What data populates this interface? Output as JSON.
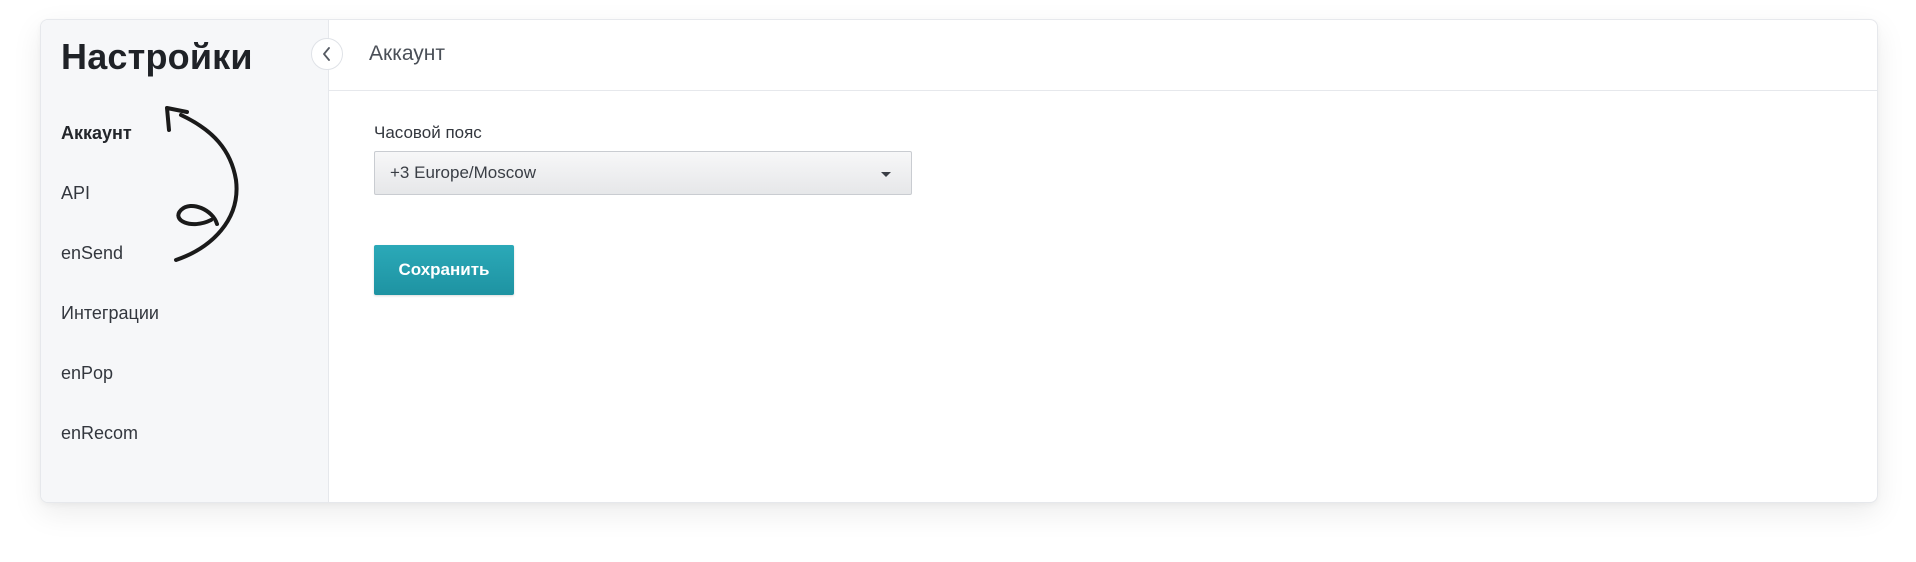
{
  "sidebar": {
    "title": "Настройки",
    "items": [
      {
        "label": "Аккаунт",
        "active": true
      },
      {
        "label": "API",
        "active": false
      },
      {
        "label": "enSend",
        "active": false
      },
      {
        "label": "Интеграции",
        "active": false
      },
      {
        "label": "enPop",
        "active": false
      },
      {
        "label": "enRecom",
        "active": false
      }
    ],
    "collapse_icon": "chevron-left-icon"
  },
  "main": {
    "title": "Аккаунт",
    "timezone": {
      "label": "Часовой пояс",
      "value": "+3 Europe/Moscow",
      "icon": "caret-down-icon"
    },
    "save_label": "Сохранить"
  },
  "colors": {
    "accent": "#2ba9b8",
    "sidebar_bg": "#f6f7f9",
    "annotation": "#1a1a1a"
  }
}
